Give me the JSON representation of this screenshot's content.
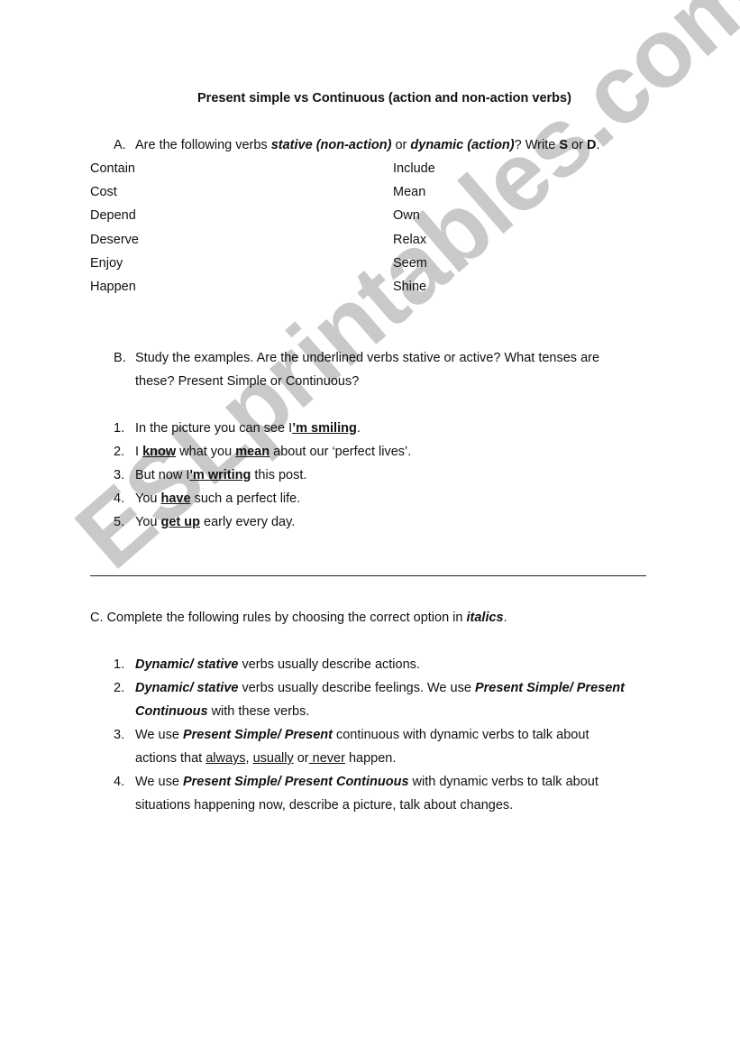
{
  "watermark": "ESLprintables.com",
  "title": "Present simple vs Continuous (action and non-action verbs)",
  "section_a": {
    "label": "A.",
    "text_1": "Are the following verbs ",
    "em_1": "stative (non-action)",
    "text_2": " or ",
    "em_2": "dynamic (action)",
    "text_3": "? Write ",
    "s": "S",
    "text_4": " or ",
    "d": "D",
    "text_5": ".",
    "left_verbs": [
      "Contain",
      "Cost",
      "Depend",
      "Deserve",
      "Enjoy",
      "Happen"
    ],
    "right_verbs": [
      "Include",
      "Mean",
      "Own",
      "Relax",
      "Seem",
      "Shine"
    ]
  },
  "section_b": {
    "label": "B.",
    "line_1": "Study the examples. Are the underlined verbs stative or active? What tenses are",
    "line_2": "these? Present Simple or Continuous?",
    "items": [
      {
        "num": "1.",
        "pre": "In the picture you can see I",
        "u1": "’m smiling",
        "post": "."
      },
      {
        "num": "2.",
        "pre": "I ",
        "u1": "know",
        "mid": " what you ",
        "u2": "mean",
        "post": " about our ‘perfect lives’."
      },
      {
        "num": "3.",
        "pre": "But now I",
        "u1": "'m writing",
        "post": " this post."
      },
      {
        "num": "4.",
        "pre": "You ",
        "u1": "have",
        "post": " such a perfect life."
      },
      {
        "num": "5.",
        "pre": "You ",
        "u1": "get up",
        "post": " early every day."
      }
    ]
  },
  "section_c": {
    "text": "C. Complete the following rules by choosing the correct option in ",
    "em": "italics",
    "end": ".",
    "rules": [
      {
        "num": "1.",
        "em1": "Dynamic/ stative",
        "t1": " verbs usually describe actions."
      },
      {
        "num": "2.",
        "em1": "Dynamic/ stative",
        "t1": " verbs usually describe feelings. We use ",
        "em2": "Present Simple/ Present",
        "em3": "Continuous",
        "t2": " with these verbs."
      },
      {
        "num": "3.",
        "t0": "We use ",
        "em1": "Present Simple/ Present",
        "t1": " continuous with dynamic verbs to talk about",
        "l2a": "actions that ",
        "u1": "always",
        "l2b": ", ",
        "u2": "usually",
        "l2c": " or",
        "u3": " never",
        "l2d": " happen."
      },
      {
        "num": "4.",
        "t0": "We use ",
        "em1": "Present Simple/ Present Continuous",
        "t1": " with dynamic verbs to talk about",
        "line2": "situations happening now, describe a picture, talk about changes."
      }
    ]
  }
}
